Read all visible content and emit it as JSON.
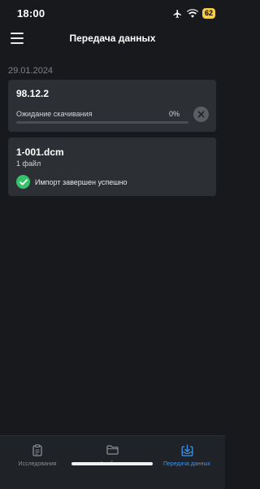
{
  "status_bar": {
    "time": "18:00",
    "battery": "62",
    "icons": [
      "airplane-icon",
      "wifi-icon",
      "battery-icon"
    ]
  },
  "header": {
    "title": "Передача данных",
    "menu_icon": "hamburger-menu-icon"
  },
  "date_group": "29.01.2024",
  "transfers": {
    "pending": {
      "name": "98.12.2",
      "status": "Ожидание скачивания",
      "progress_text": "0%",
      "progress": 0,
      "action_icon": "close-icon"
    },
    "completed": {
      "name": "1-001.dcm",
      "file_count": "1 файл",
      "status": "Импорт завершен успешно",
      "status_icon": "check-icon"
    }
  },
  "tab_bar": {
    "tabs": [
      {
        "label": "Исследования",
        "icon": "clipboard-icon",
        "active": false
      },
      {
        "label": "Альбомы",
        "icon": "folder-icon",
        "active": false
      },
      {
        "label": "Передача данных",
        "icon": "download-tray-icon",
        "active": true
      }
    ]
  },
  "colors": {
    "background": "#17191c",
    "card": "#2c2f33",
    "accent": "#3d95f2",
    "success": "#35c26b",
    "battery": "#f5cd46"
  }
}
